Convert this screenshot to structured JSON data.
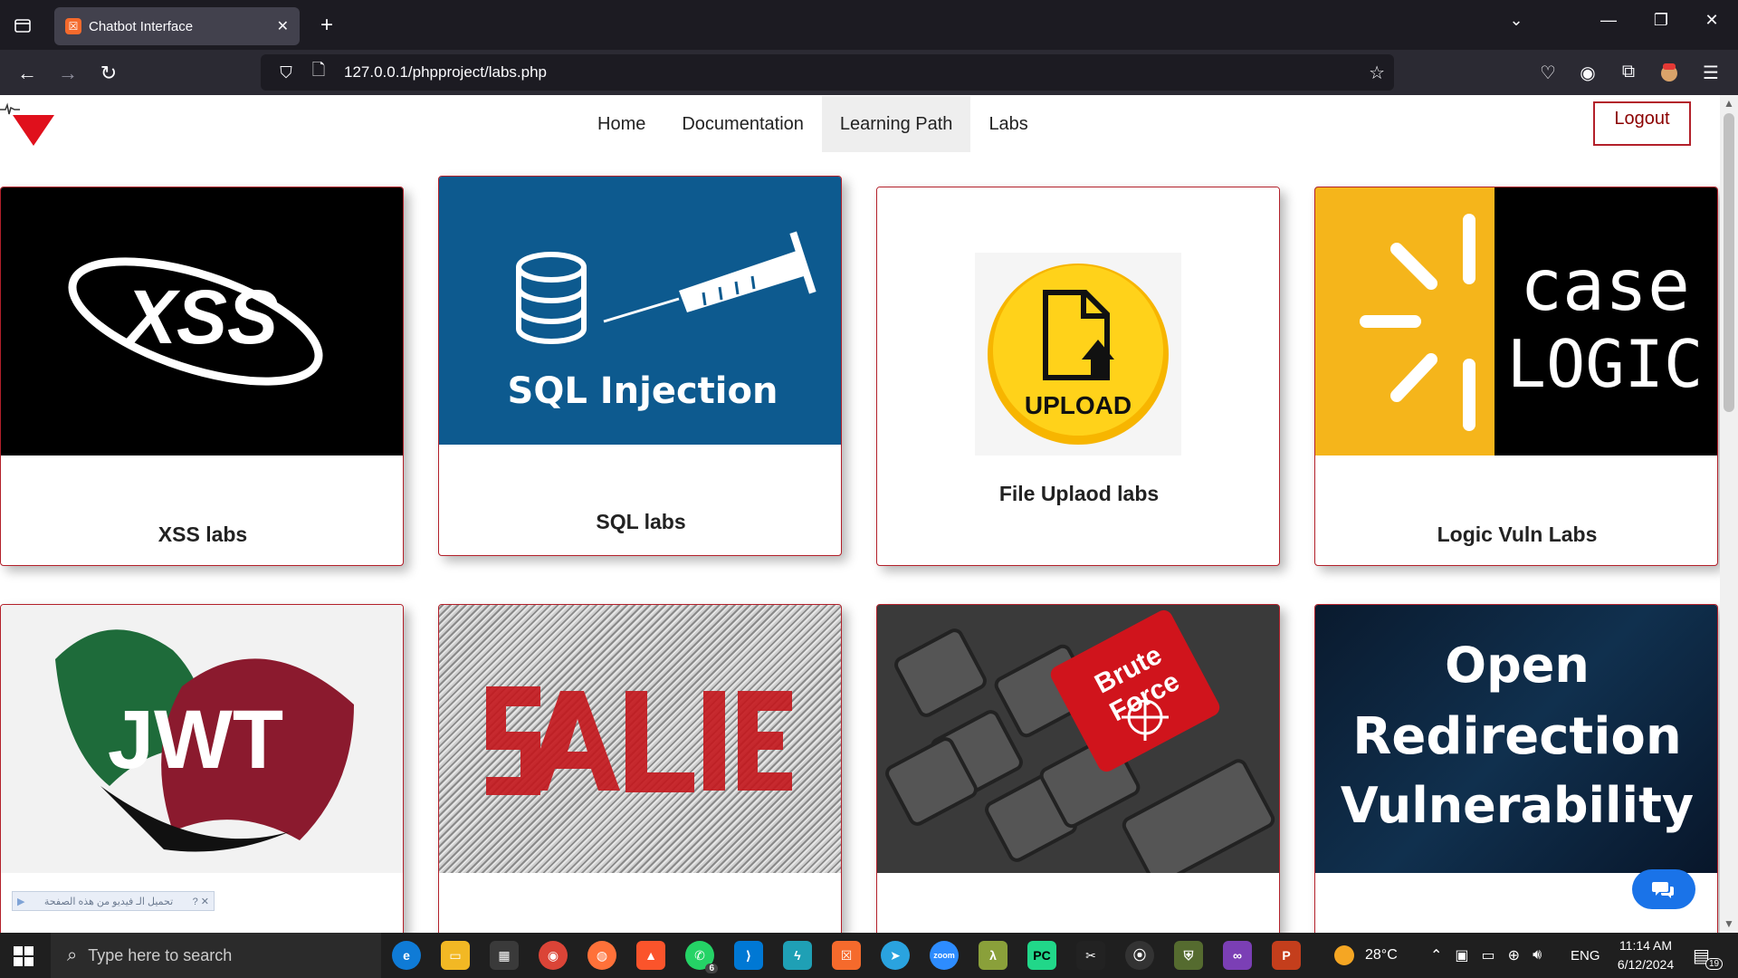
{
  "browser": {
    "tab_title": "Chatbot Interface",
    "tab_favicon_text": "☒",
    "url": "127.0.0.1/phpproject/labs.php"
  },
  "site": {
    "nav": [
      "Home",
      "Documentation",
      "Learning Path",
      "Labs"
    ],
    "active_nav": "Learning Path",
    "logout_label": "Logout"
  },
  "cards": [
    {
      "label": "XSS labs",
      "image_text": "XSS",
      "image": "xss-logo"
    },
    {
      "label": "SQL labs",
      "image_text": "SQL Injection",
      "image": "sql-injection-illustration"
    },
    {
      "label": "File Uplaod labs",
      "image_text": "UPLOAD",
      "image": "upload-button-illustration"
    },
    {
      "label": "Logic Vuln Labs",
      "image_text_1": "case",
      "image_text_2": "LOGIC",
      "image": "case-logic-logo"
    },
    {
      "label": "",
      "image_text": "JWT",
      "image": "jwt-logo",
      "overlay_text": "تحميل الـ فيديو من هذه الصفحة"
    },
    {
      "label": "",
      "image": "binary-matrix-illustration"
    },
    {
      "label": "",
      "image_text_1": "Brute",
      "image_text_2": "Force",
      "image": "brute-force-keyboard"
    },
    {
      "label": "",
      "image_text_1": "Open",
      "image_text_2": "Redirection",
      "image_text_3": "Vulnerability",
      "image": "open-redirect-banner"
    }
  ],
  "taskbar": {
    "search_placeholder": "Type here to search",
    "weather": "28°C",
    "language": "ENG",
    "time": "11:14 AM",
    "date": "6/12/2024",
    "notification_count": "19",
    "whatsapp_badge": "6"
  },
  "colors": {
    "accent_red": "#b3202a",
    "chrome_dark": "#1c1b22",
    "chrome_mid": "#2b2a33",
    "sql_blue": "#0d5a8f",
    "case_yellow": "#f5b51b",
    "chat_blue": "#1a73e8"
  }
}
